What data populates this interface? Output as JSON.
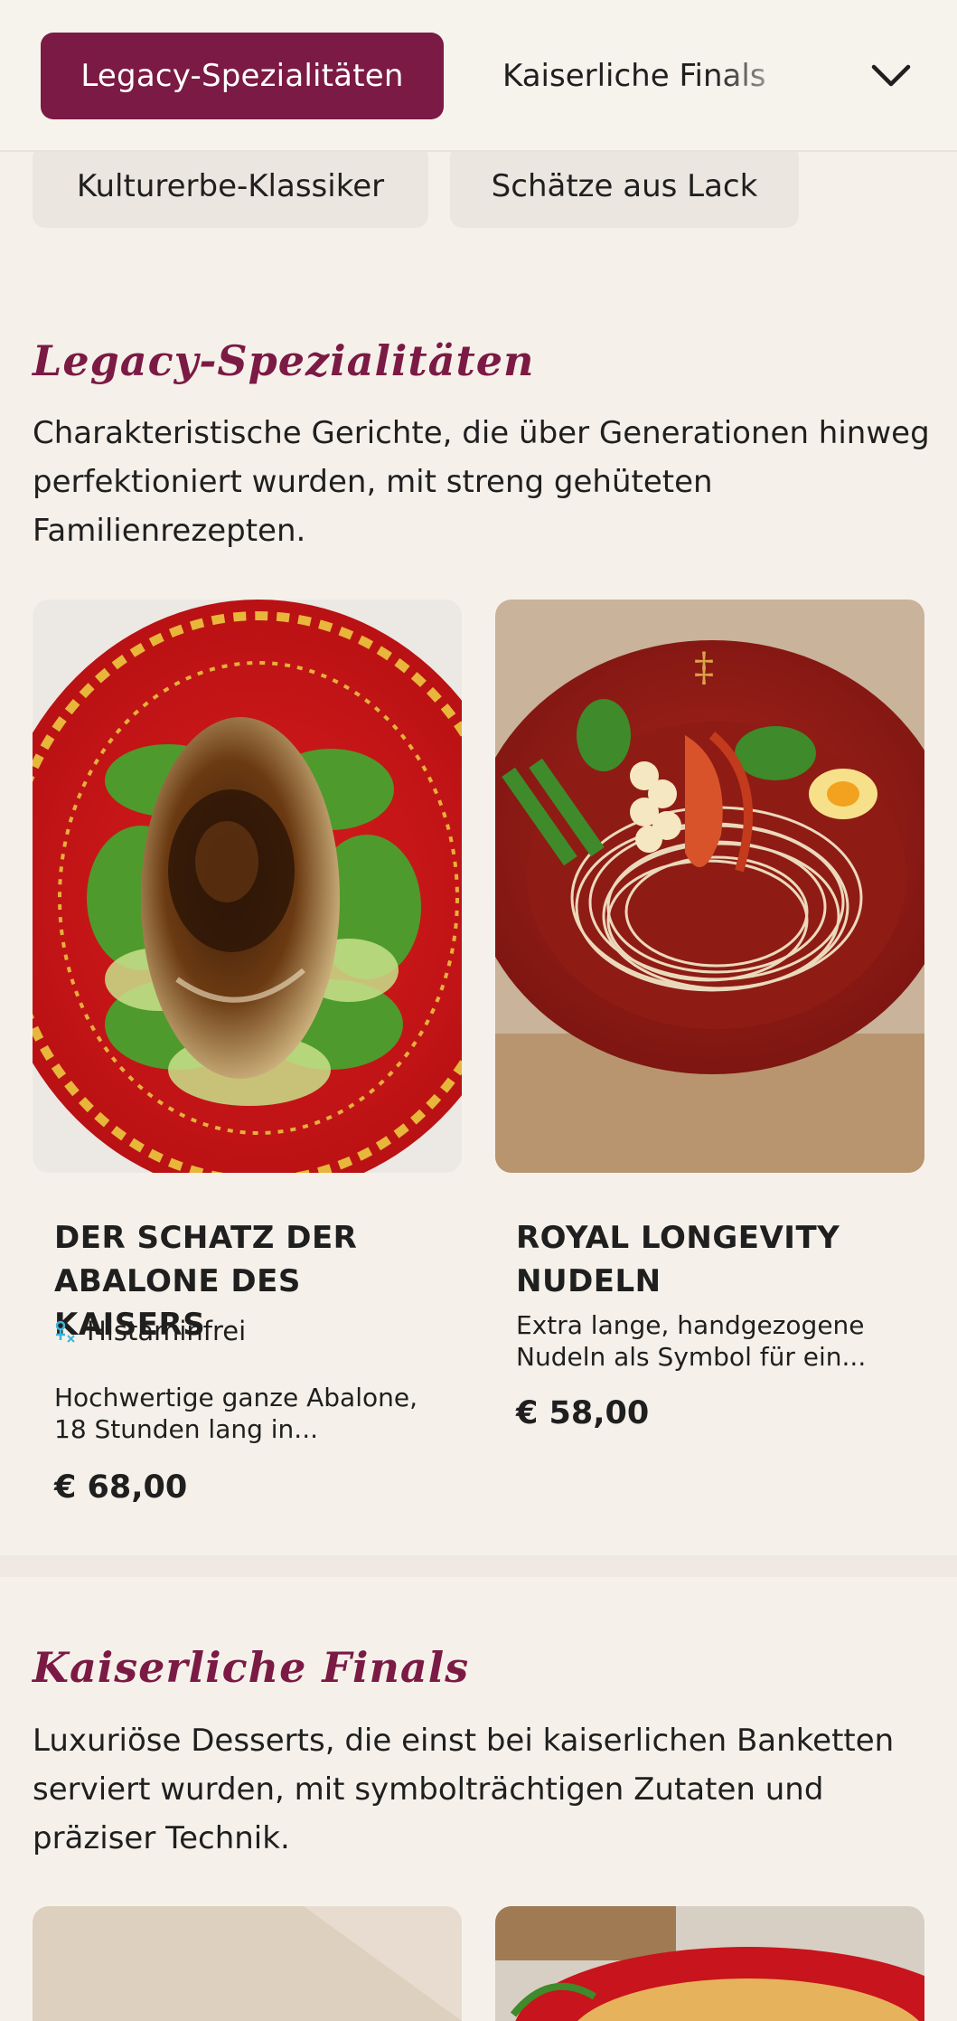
{
  "nav": {
    "active_tab": "Legacy-Spezialitäten",
    "tab_2": "Kaiserliche Finals",
    "chips": [
      "Kulturerbe-Klassiker",
      "Schätze aus Lack"
    ],
    "accent": "#7b1a44"
  },
  "sections": [
    {
      "title": "Legacy-Spezialitäten",
      "description": "Charakteristische Gerichte, die über Generationen hinweg perfektioniert wurden, mit streng gehüteten Familienrezepten.",
      "items": [
        {
          "name": "DER SCHATZ DER ABALONE DES KAISERS",
          "allergen": "Histaminfrei",
          "allergen_icon": "histamine-free-icon",
          "description": "Hochwertige ganze Abalone, 18 Stunden lang in...",
          "price": "€ 68,00"
        },
        {
          "name": "ROYAL LONGEVITY NUDELN",
          "description": "Extra lange, handgezogene Nudeln als Symbol für ein...",
          "price": "€ 58,00"
        }
      ]
    },
    {
      "title": "Kaiserliche Finals",
      "description": "Luxuriöse Desserts, die einst bei kaiserlichen Banketten serviert wurden, mit symbolträchtigen Zutaten und präziser Technik."
    }
  ]
}
